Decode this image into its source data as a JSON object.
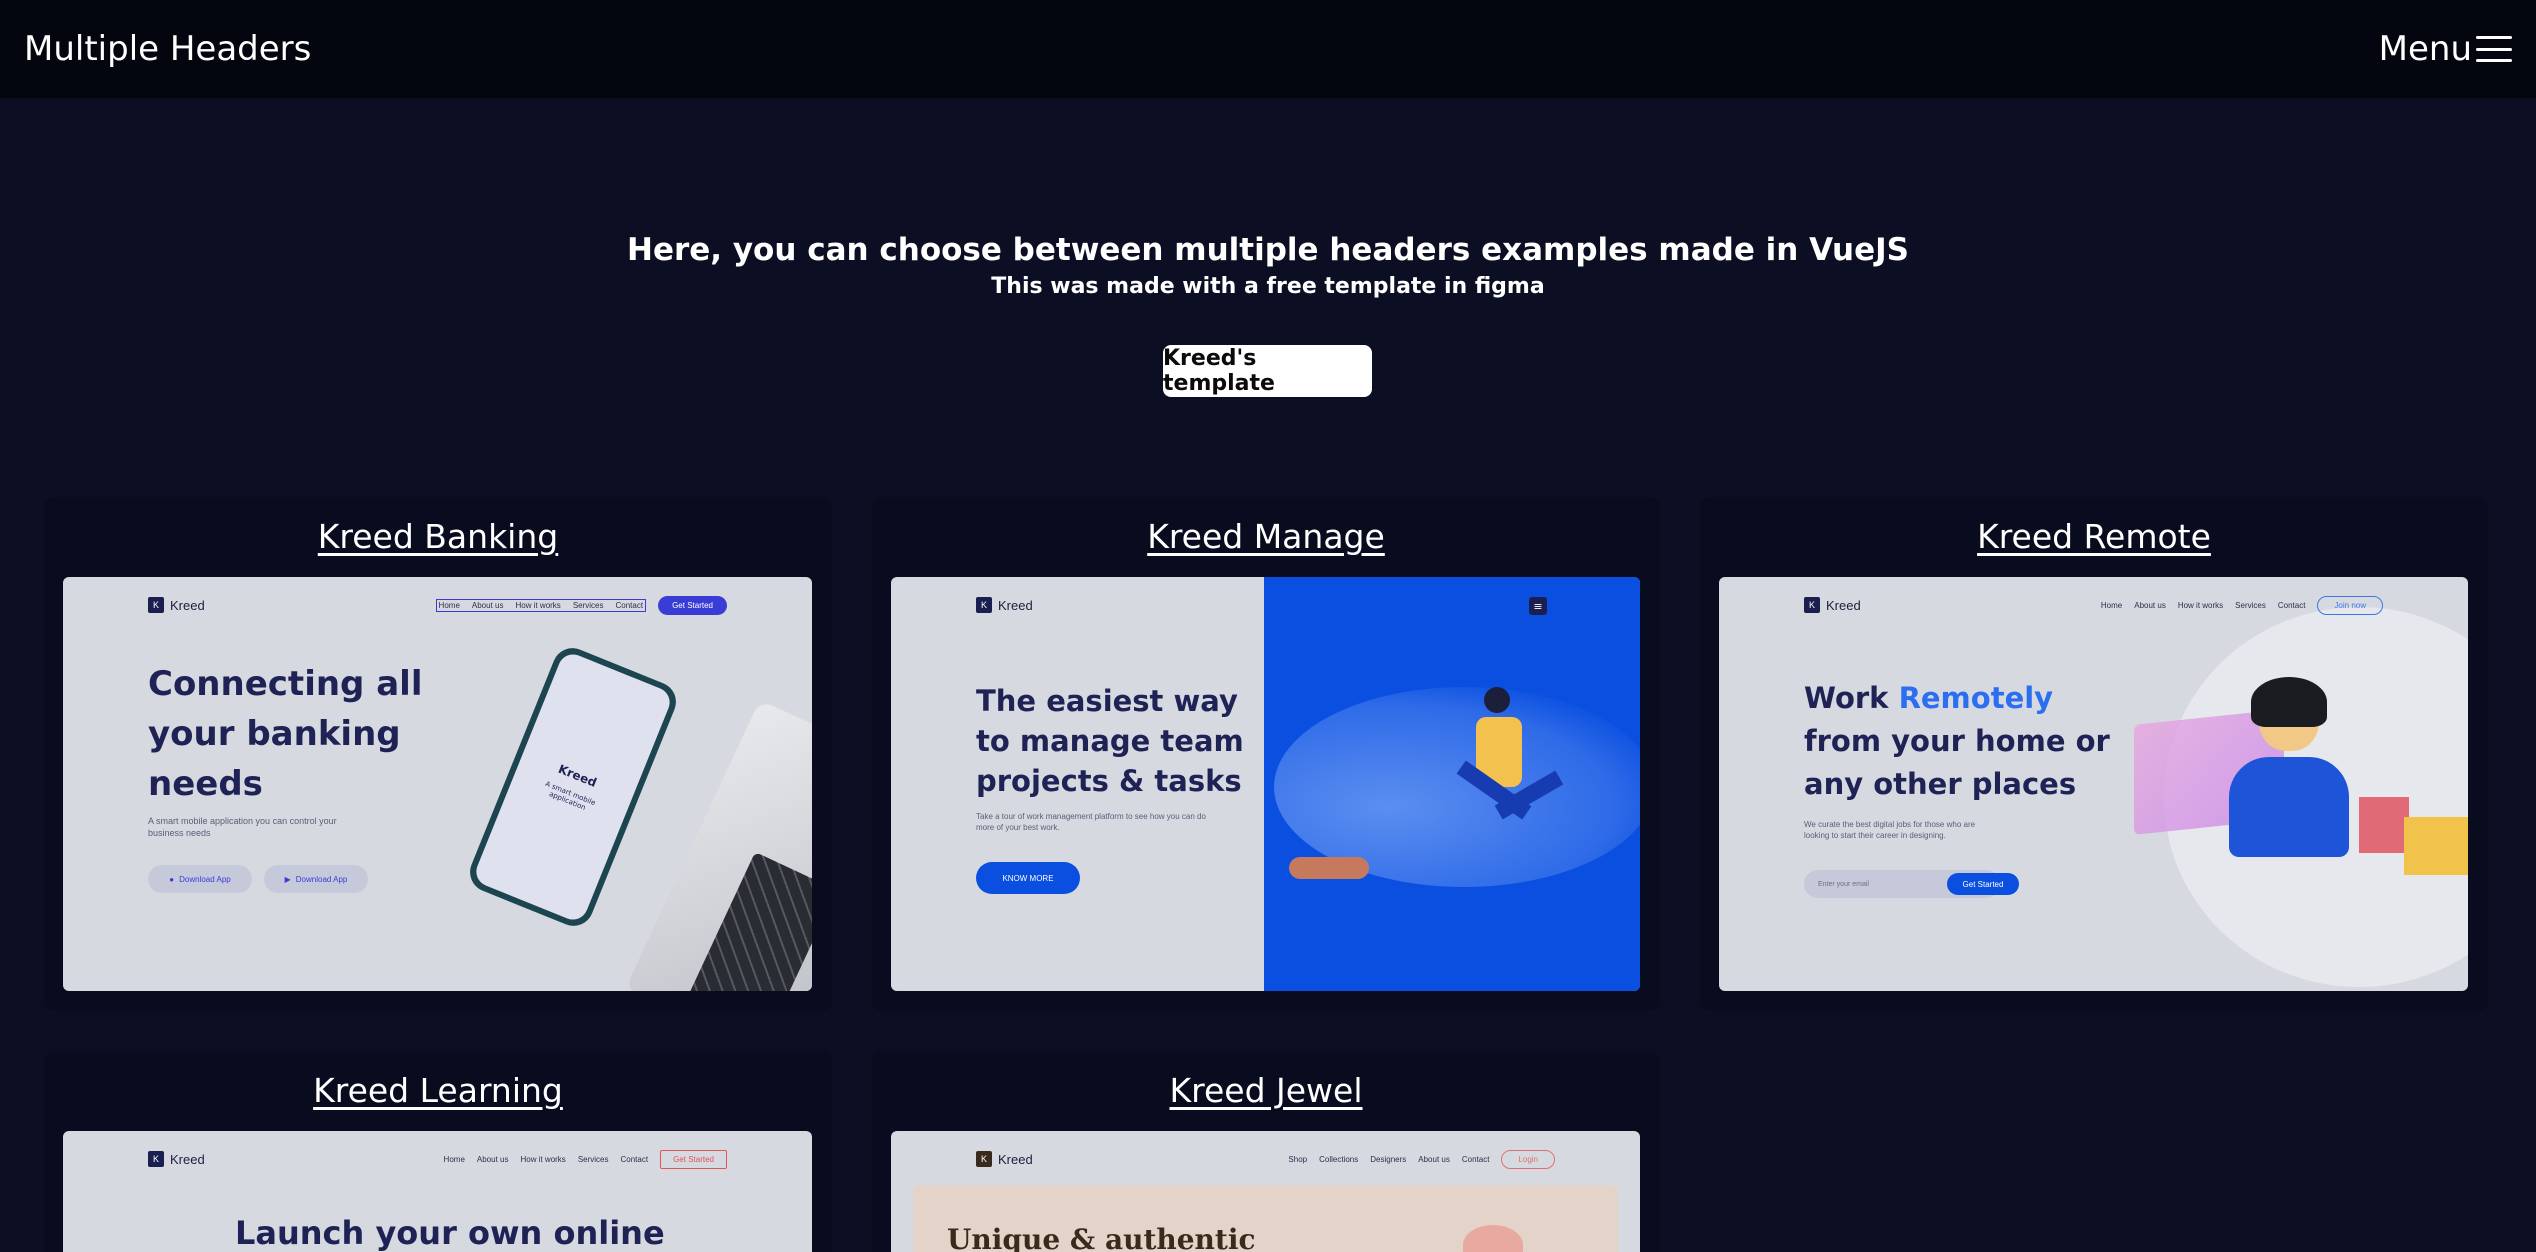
{
  "header": {
    "brand": "Multiple Headers",
    "menu_label": "Menu"
  },
  "intro": {
    "title": "Here, you can choose between multiple headers examples made in VueJS",
    "subtitle": "This was made with a free template in figma",
    "button_label": "Kreed's template"
  },
  "cards": {
    "banking": {
      "title": "Kreed Banking",
      "logo": "Kreed",
      "logo_mark": "K",
      "nav": [
        "Home",
        "About us",
        "How it works",
        "Services",
        "Contact"
      ],
      "cta": "Get Started",
      "hero_line1": "Connecting all",
      "hero_line2": "your banking",
      "hero_line3": "needs",
      "sub_line1": "A smart mobile application you can control your",
      "sub_line2": "business needs",
      "download1": "Download App",
      "download2": "Download App",
      "phone_logo": "Kreed",
      "phone_caption": "A smart mobile application"
    },
    "manage": {
      "title": "Kreed Manage",
      "logo": "Kreed",
      "logo_mark": "K",
      "hero_line1": "The easiest way",
      "hero_line2": "to manage team",
      "hero_line3": "projects & tasks",
      "sub_line1": "Take a tour of work management platform to see how you can do",
      "sub_line2": "more of your best work.",
      "cta": "KNOW MORE"
    },
    "remote": {
      "title": "Kreed Remote",
      "logo": "Kreed",
      "logo_mark": "K",
      "nav": [
        "Home",
        "About us",
        "How it works",
        "Services",
        "Contact"
      ],
      "cta": "Join now",
      "hero_word1": "Work ",
      "hero_accent": "Remotely",
      "hero_line2": "from your home or",
      "hero_line3": "any other places",
      "sub_line1": "We curate the best digital jobs for those who are",
      "sub_line2": "looking to start their career in designing.",
      "email_placeholder": "Enter your email",
      "email_cta": "Get Started"
    },
    "learning": {
      "title": "Kreed Learning",
      "logo": "Kreed",
      "logo_mark": "K",
      "nav": [
        "Home",
        "About us",
        "How it works",
        "Services",
        "Contact"
      ],
      "cta": "Get Started",
      "hero_line1": "Launch your own online"
    },
    "jewel": {
      "title": "Kreed Jewel",
      "logo": "Kreed",
      "logo_mark": "K",
      "nav": [
        "Shop",
        "Collections",
        "Designers",
        "About us",
        "Contact"
      ],
      "cta": "Login",
      "hero_line1": "Unique & authentic"
    }
  },
  "colors": {
    "page_bg": "#0c0f24",
    "topbar_bg": "#04060f",
    "card_bg": "#090c1f",
    "accent_blue": "#0a4fe0",
    "navy_text": "#1e2255"
  }
}
